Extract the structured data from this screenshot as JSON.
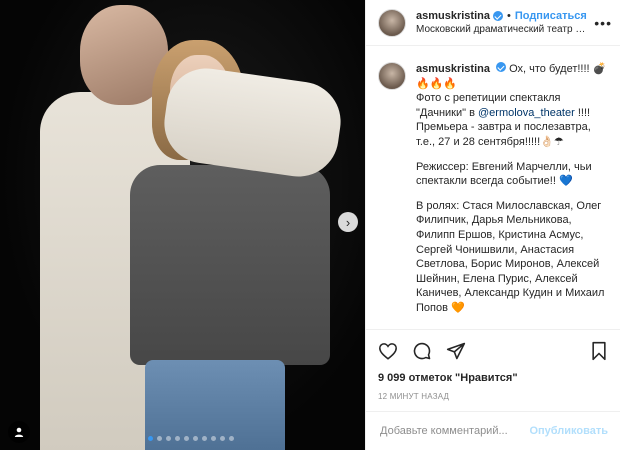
{
  "header": {
    "username": "asmuskristina",
    "separator": "•",
    "follow_label": "Подписаться",
    "location": "Московский драматический театр имени М...",
    "more": "•••"
  },
  "caption": {
    "username": "asmuskristina",
    "first_text": "Ох, что будет!!!! 💣🔥🔥🔥",
    "line2_pre": "Фото с репетиции спектакля \"Дачники\" в ",
    "mention": "@ermolova_theater",
    "line2_post": " !!!! Премьера - завтра и послезавтра, т.е., 27 и 28 сентября!!!!!👌🏻☂",
    "paragraph2": "Режиссер: Евгений Марчелли, чьи спектакли всегда событие!! 💙",
    "paragraph3": "В ролях: Стася Милославская, Олег Филипчик, Дарья Мельникова, Филипп Ершов, Кристина Асмус, Сергей Чонишвили, Анастасия Светлова, Борис Миронов, Алексей Шейнин, Елена Пурис, Алексей Каничев, Александр Кудин и Михаил Попов 🧡"
  },
  "engagement": {
    "likes": "9 099 отметок \"Нравится\"",
    "time": "12 МИНУТ НАЗАД"
  },
  "comment": {
    "placeholder": "Добавьте комментарий...",
    "publish_label": "Опубликовать"
  },
  "photo": {
    "next_arrow": "›",
    "carousel_dots": 10,
    "active_dot": 1
  }
}
